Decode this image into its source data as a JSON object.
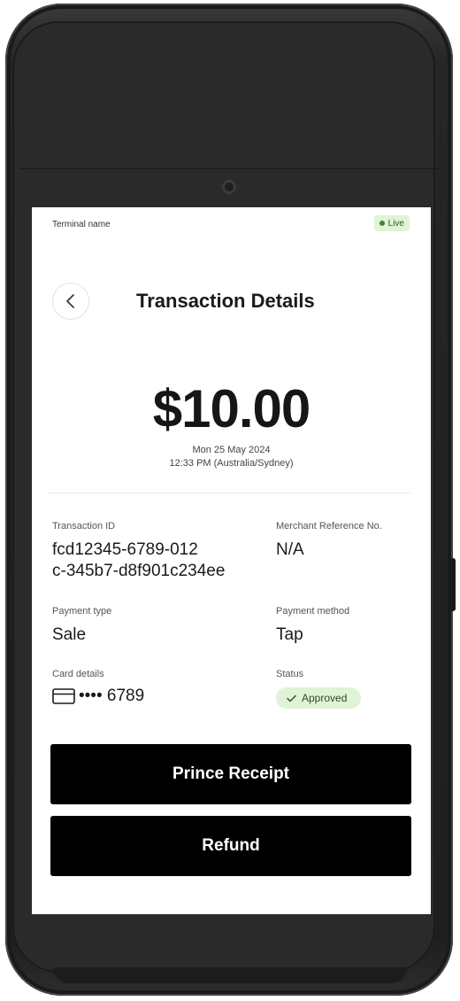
{
  "header": {
    "terminal_name": "Terminal name",
    "live_label": "Live"
  },
  "title": "Transaction Details",
  "amount": "$10.00",
  "date": "Mon 25 May 2024",
  "time": "12:33 PM (Australia/Sydney)",
  "fields": {
    "transaction_id_label": "Transaction ID",
    "transaction_id_line1": "fcd12345-6789-012",
    "transaction_id_line2": "c-345b7-d8f901c234ee",
    "merchant_ref_label": "Merchant Reference No.",
    "merchant_ref_value": "N/A",
    "payment_type_label": "Payment type",
    "payment_type_value": "Sale",
    "payment_method_label": "Payment method",
    "payment_method_value": "Tap",
    "card_details_label": "Card details",
    "card_masked": "•••• 6789",
    "status_label": "Status",
    "status_value": "Approved"
  },
  "buttons": {
    "print_receipt": "Prince Receipt",
    "refund": "Refund"
  },
  "colors": {
    "live_badge_bg": "#dff3d6",
    "live_dot": "#3a8a2a",
    "status_badge_bg": "#dff3d6",
    "button_bg": "#000000",
    "device_body": "#222222"
  },
  "icons": {
    "back": "chevron-left-icon",
    "card": "credit-card-icon",
    "status": "check-icon",
    "live": "dot-icon"
  }
}
